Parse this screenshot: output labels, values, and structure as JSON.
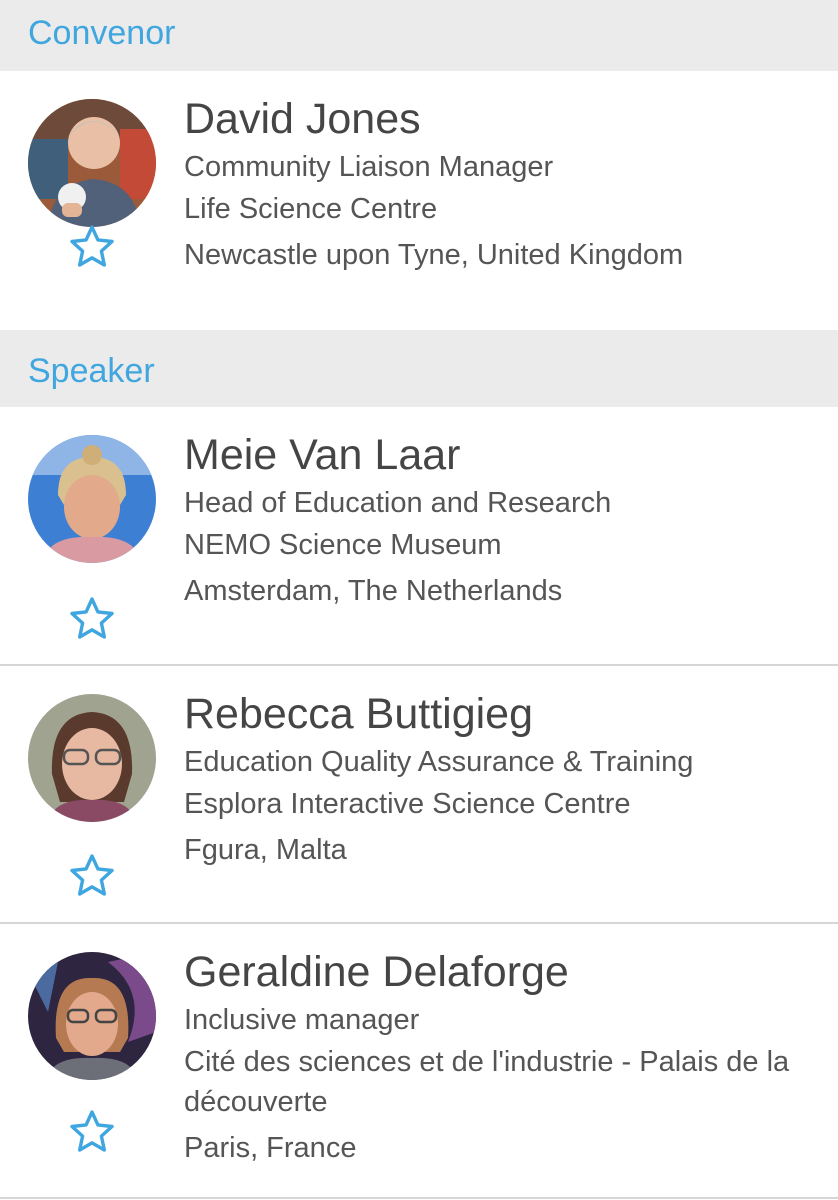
{
  "sections": [
    {
      "title": "Convenor",
      "people": [
        {
          "name": "David Jones",
          "role": "Community Liaison Manager",
          "organization": "Life Science Centre",
          "location": "Newcastle upon Tyne, United Kingdom",
          "favorite_icon": "star-outline-icon"
        }
      ]
    },
    {
      "title": "Speaker",
      "people": [
        {
          "name": "Meie Van Laar",
          "role": "Head of Education and Research",
          "organization": "NEMO Science Museum",
          "location": "Amsterdam, The Netherlands",
          "favorite_icon": "star-outline-icon"
        },
        {
          "name": "Rebecca Buttigieg",
          "role": "Education Quality Assurance & Training",
          "organization": "Esplora Interactive Science Centre",
          "location": "Fgura, Malta",
          "favorite_icon": "star-outline-icon"
        },
        {
          "name": "Geraldine Delaforge",
          "role": "Inclusive manager",
          "organization": "Cité des sciences et de l'industrie - Palais de la découverte",
          "location": "Paris, France",
          "favorite_icon": "star-outline-icon"
        }
      ]
    }
  ],
  "colors": {
    "accent": "#3fa6e0",
    "section_background": "#ebebeb",
    "text": "#454545",
    "divider": "#d6d6d6"
  }
}
